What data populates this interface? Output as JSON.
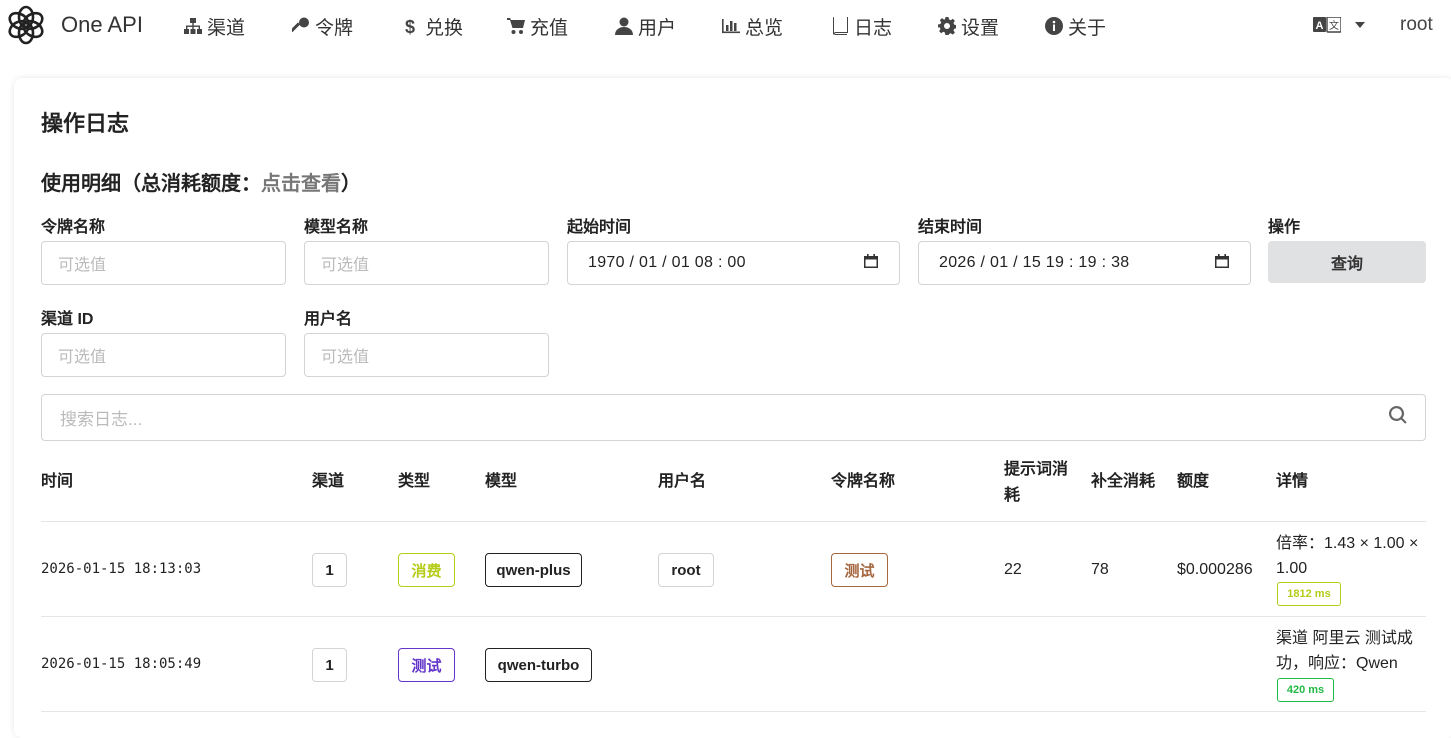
{
  "app": {
    "brand": "One API",
    "logo_icon": "openai-logo-icon"
  },
  "nav": [
    {
      "label": "渠道",
      "icon": "sitemap-icon"
    },
    {
      "label": "令牌",
      "icon": "key-icon"
    },
    {
      "label": "兑换",
      "icon": "dollar-icon"
    },
    {
      "label": "充值",
      "icon": "cart-icon"
    },
    {
      "label": "用户",
      "icon": "user-icon"
    },
    {
      "label": "总览",
      "icon": "bar-chart-icon"
    },
    {
      "label": "日志",
      "icon": "book-icon"
    },
    {
      "label": "设置",
      "icon": "gear-icon"
    },
    {
      "label": "关于",
      "icon": "info-icon"
    }
  ],
  "header_right": {
    "language_icon": "language-icon",
    "user": "root"
  },
  "page": {
    "title": "操作日志",
    "subtitle_prefix": "使用明细（总消耗额度：",
    "subtitle_link": "点击查看",
    "subtitle_suffix": "）"
  },
  "filters": {
    "token_label": "令牌名称",
    "token_placeholder": "可选值",
    "model_label": "模型名称",
    "model_placeholder": "可选值",
    "start_label": "起始时间",
    "start_value": "1970 / 01 / 01   08 : 00",
    "end_label": "结束时间",
    "end_value": "2026 / 01 / 15   19 : 19 : 38",
    "action_label": "操作",
    "query_button": "查询",
    "channel_label": "渠道 ID",
    "channel_placeholder": "可选值",
    "username_label": "用户名",
    "username_placeholder": "可选值"
  },
  "search": {
    "placeholder": "搜索日志..."
  },
  "table": {
    "columns": [
      "时间",
      "渠道",
      "类型",
      "模型",
      "用户名",
      "令牌名称",
      "提示词消耗",
      "补全消耗",
      "额度",
      "详情"
    ],
    "rows": [
      {
        "time": "2026-01-15 18:13:03",
        "channel": "1",
        "type": "消费",
        "type_color": "#b5cc18",
        "model": "qwen-plus",
        "username": "root",
        "token": "测试",
        "prompt_tokens": "22",
        "completion_tokens": "78",
        "quota": "$0.000286",
        "detail": "倍率：1.43 × 1.00 × 1.00",
        "latency": "1812 ms"
      },
      {
        "time": "2026-01-15 18:05:49",
        "channel": "1",
        "type": "测试",
        "type_color": "#6435c9",
        "model": "qwen-turbo",
        "username": "",
        "token": "",
        "prompt_tokens": "",
        "completion_tokens": "",
        "quota": "",
        "detail": "渠道 阿里云 测试成功，响应：Qwen",
        "latency": "420 ms"
      }
    ]
  },
  "colors": {
    "olive": "#b5cc18",
    "violet": "#6435c9",
    "brown": "#a5673f",
    "green": "#21ba45",
    "button_bg": "#e0e1e2"
  }
}
